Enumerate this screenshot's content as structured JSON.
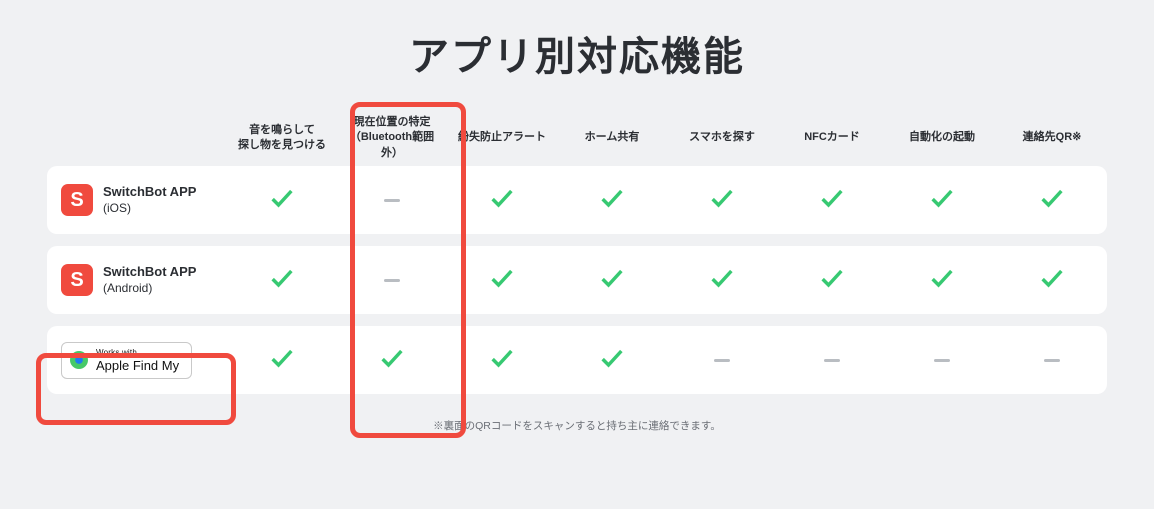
{
  "title": "アプリ別対応機能",
  "headers": [
    "音を鳴らして\n探し物を見つける",
    "現在位置の特定\n（Bluetooth範囲\n外）",
    "紛失防止アラート",
    "ホーム共有",
    "スマホを探す",
    "NFCカード",
    "自動化の起動",
    "連絡先QR※"
  ],
  "rows": [
    {
      "icon_type": "switchbot",
      "icon_letter": "S",
      "app_name": "SwitchBot APP",
      "app_sub": "(iOS)",
      "values": [
        "check",
        "dash",
        "check",
        "check",
        "check",
        "check",
        "check",
        "check"
      ]
    },
    {
      "icon_type": "switchbot",
      "icon_letter": "S",
      "app_name": "SwitchBot APP",
      "app_sub": "(Android)",
      "values": [
        "check",
        "dash",
        "check",
        "check",
        "check",
        "check",
        "check",
        "check"
      ]
    },
    {
      "icon_type": "findmy",
      "findmy_works": "Works with",
      "findmy_main": "Apple Find My",
      "values": [
        "check",
        "check",
        "check",
        "check",
        "dash",
        "dash",
        "dash",
        "dash"
      ]
    }
  ],
  "footnote": "※裏面のQRコードをスキャンすると持ち主に連絡できます。",
  "chart_data": {
    "type": "table",
    "title": "アプリ別対応機能",
    "columns": [
      "音を鳴らして探し物を見つける",
      "現在位置の特定（Bluetooth範囲外）",
      "紛失防止アラート",
      "ホーム共有",
      "スマホを探す",
      "NFCカード",
      "自動化の起動",
      "連絡先QR"
    ],
    "rows": [
      {
        "app": "SwitchBot APP (iOS)",
        "values": [
          true,
          false,
          true,
          true,
          true,
          true,
          true,
          true
        ]
      },
      {
        "app": "SwitchBot APP (Android)",
        "values": [
          true,
          false,
          true,
          true,
          true,
          true,
          true,
          true
        ]
      },
      {
        "app": "Works with Apple Find My",
        "values": [
          true,
          true,
          true,
          true,
          false,
          false,
          false,
          false
        ]
      }
    ],
    "highlighted_column_index": 1,
    "highlighted_row_index": 2
  }
}
